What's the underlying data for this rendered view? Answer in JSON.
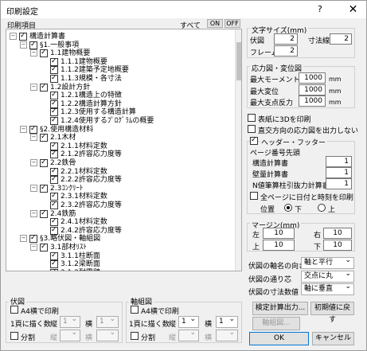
{
  "window": {
    "title": "印刷設定",
    "help": "?",
    "close": "✕"
  },
  "left": {
    "label": "印刷項目",
    "all_label": "すべて",
    "on": "ON",
    "off": "OFF"
  },
  "tree": [
    "構造計算書",
    "§1.一般事項",
    "1.1建物概要",
    "1.1.1建物概要",
    "1.1.2建築予定地概要",
    "1.1.3規模・各寸法",
    "1.2設計方針",
    "1.2.1構造上の特徴",
    "1.2.2構造計算方針",
    "1.2.3使用する構造計算",
    "1.2.4使用するﾌﾟﾛｸﾞﾗﾑの概要",
    "§2.使用構造材料",
    "2.1木材",
    "2.1.1材料定数",
    "2.1.2許容応力度等",
    "2.2鉄骨",
    "2.2.1材料定数",
    "2.2.2許容応力度等",
    "2.3ｺﾝｸﾘｰﾄ",
    "2.3.1材料定数",
    "2.3.2許容応力度等",
    "2.4鉄筋",
    "2.4.1材料定数",
    "2.4.2許容応力度等",
    "§3.略伏図・軸組図",
    "3.1部材ﾘｽﾄ",
    "3.1.1柱断面",
    "3.1.2梁断面",
    "3.1.3耐震壁"
  ],
  "fukuzu": {
    "label": "伏図",
    "a4": "A4横で印刷",
    "per_page": "1頁に描く数",
    "tate": "縦",
    "yoko": "横",
    "tate_val": "1",
    "yoko_val": "1",
    "split": "分割"
  },
  "jikugumi": {
    "label": "軸組図",
    "a4": "A4横で印刷",
    "per_page": "1頁に描く数",
    "tate": "縦",
    "yoko": "横",
    "tate_val": "1",
    "yoko_val": "1",
    "split": "分割"
  },
  "font": {
    "label": "文字サイズ(mm)",
    "fukuzu": "伏図",
    "fukuzu_val": "2",
    "sunpo": "寸法線",
    "sunpo_val": "2",
    "frame": "フレーム図",
    "frame_val": "2"
  },
  "stress": {
    "label": "応力図・変位図",
    "moment": "最大モーメント",
    "moment_val": "1000",
    "disp": "最大変位",
    "disp_val": "1000",
    "reaction": "最大支点反力",
    "reaction_val": "1000",
    "unit": "mm"
  },
  "checks": {
    "cover_3d": "表紙に3Dを印刷",
    "orthogonal": "直交方向の応力図を出力しない"
  },
  "header": {
    "label": "ヘッダー・フッター",
    "page_start": "ページ番号先頭",
    "structure": "構造計算書",
    "structure_val": "1",
    "wall": "壁量計算書",
    "wall_val": "1",
    "n": "N値筆算柱引抜力計算書",
    "n_val": "1",
    "datetime": "全ページに日付と時刻を印刷",
    "position": "位置",
    "bottom": "下",
    "top": "上"
  },
  "margin": {
    "label": "マージン(mm)",
    "left": "左",
    "left_val": "10",
    "right": "右",
    "right_val": "10",
    "top": "上",
    "top_val": "10",
    "bottom": "下",
    "bottom_val": "10"
  },
  "options": {
    "axis_dir": "伏図の軸名の向き",
    "axis_dir_val": "軸と平行",
    "xp": "伏図の通り芯",
    "xp_val": "交点に丸",
    "dim": "伏図の寸法数値",
    "dim_val": "軸に垂直"
  },
  "buttons": {
    "export": "検定計算出力...",
    "reset": "初期値に戻す",
    "axis": "軸組図...",
    "ok": "OK",
    "cancel": "キャンセル"
  }
}
